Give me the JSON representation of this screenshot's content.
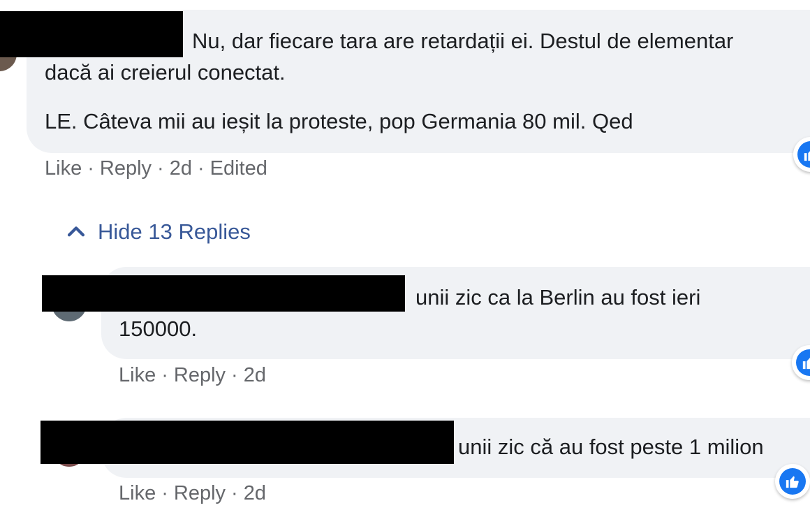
{
  "comments": [
    {
      "text_line1": "Nu, dar fiecare tara are retardații ei. Destul de elementar",
      "text_line2": "dacă ai creierul conectat.",
      "text_line3": "LE. Câteva mii au ieșit la proteste, pop Germania 80 mil. Qed",
      "actions": {
        "like": "Like",
        "reply": "Reply",
        "time": "2d",
        "edited": "Edited",
        "separator": "·"
      }
    }
  ],
  "hide_replies_label": "Hide 13 Replies",
  "replies": [
    {
      "text_line1": "unii zic ca la Berlin au fost ieri",
      "text_line2": "150000.",
      "actions": {
        "like": "Like",
        "reply": "Reply",
        "time": "2d",
        "separator": "·"
      }
    },
    {
      "text_line1": "unii zic că au fost peste 1 milion",
      "actions": {
        "like": "Like",
        "reply": "Reply",
        "time": "2d",
        "separator": "·"
      }
    }
  ],
  "colors": {
    "bubble": "#f0f2f5",
    "link_blue": "#385898",
    "meta_gray": "#65676b",
    "like_blue": "#1877f2"
  },
  "icons": [
    "chevron-up-icon",
    "like-reaction-icon"
  ]
}
